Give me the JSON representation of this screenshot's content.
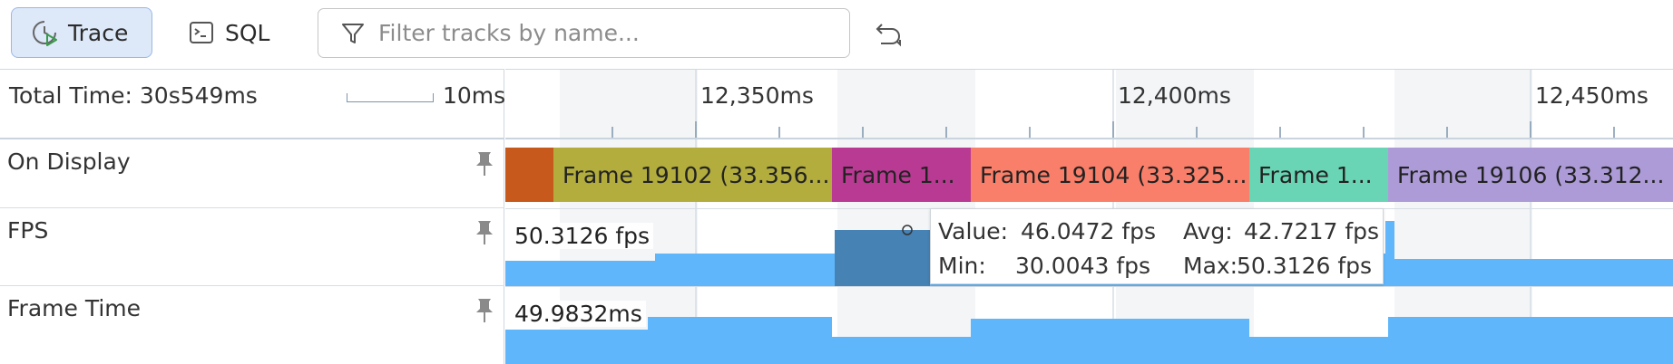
{
  "toolbar": {
    "trace_label": "Trace",
    "sql_label": "SQL",
    "filter_placeholder": "Filter tracks by name...",
    "icons": {
      "trace": "trace-icon",
      "sql": "terminal-icon",
      "filter": "filter-icon",
      "reset": "reset-zoom-icon"
    }
  },
  "timeline": {
    "total_time": "Total Time: 30s549ms",
    "scale_label": "10ms",
    "ticks": [
      "12,350ms",
      "12,400ms",
      "12,450ms"
    ]
  },
  "tracks": [
    {
      "name": "On Display"
    },
    {
      "name": "FPS"
    },
    {
      "name": "Frame Time"
    }
  ],
  "display_slices": [
    {
      "label": "",
      "color": "#c8591c"
    },
    {
      "label": "Frame 19102 (33.356...",
      "color": "#b2ad3d"
    },
    {
      "label": "Frame 1...",
      "color": "#b93a93"
    },
    {
      "label": "Frame 19104 (33.325...",
      "color": "#f97f6a"
    },
    {
      "label": "Frame 1...",
      "color": "#6ad5b4"
    },
    {
      "label": "Frame 19106 (33.312...",
      "color": "#ad9bd8"
    }
  ],
  "fps_track": {
    "value_label": "50.3126 fps",
    "bar_color": "#60b6fb",
    "selected_color": "#4682b4"
  },
  "frame_time_track": {
    "value_label": "49.9832ms",
    "bar_color": "#60b6fb"
  },
  "tooltip": {
    "value_key": "Value:",
    "value": "46.0472 fps",
    "avg_key": "Avg:",
    "avg": "42.7217 fps",
    "min_key": "Min:",
    "min": "30.0043 fps",
    "max_key": "Max:",
    "max": "50.3126 fps"
  },
  "colors": {
    "accent": "#dde8f8",
    "bar": "#60b6fb",
    "selected": "#4682b4"
  }
}
